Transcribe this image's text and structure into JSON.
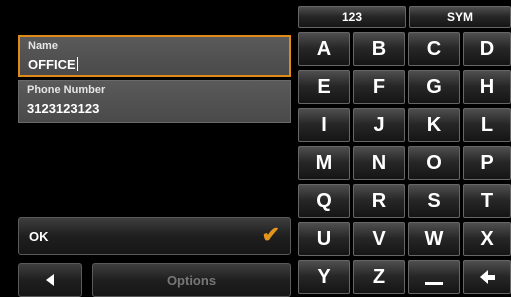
{
  "form": {
    "name": {
      "label": "Name",
      "value": "OFFICE"
    },
    "phone": {
      "label": "Phone Number",
      "value": "3123123123"
    }
  },
  "actions": {
    "ok_label": "OK",
    "options_label": "Options"
  },
  "keyboard": {
    "modes": [
      "123",
      "SYM"
    ],
    "rows": [
      [
        "A",
        "B",
        "C",
        "D"
      ],
      [
        "E",
        "F",
        "G",
        "H"
      ],
      [
        "I",
        "J",
        "K",
        "L"
      ],
      [
        "M",
        "N",
        "O",
        "P"
      ],
      [
        "Q",
        "R",
        "S",
        "T"
      ],
      [
        "U",
        "V",
        "W",
        "X"
      ],
      [
        "Y",
        "Z"
      ]
    ]
  },
  "colors": {
    "accent": "#e08a1c",
    "field_bg": "#515151",
    "key_bg": "#262626"
  }
}
